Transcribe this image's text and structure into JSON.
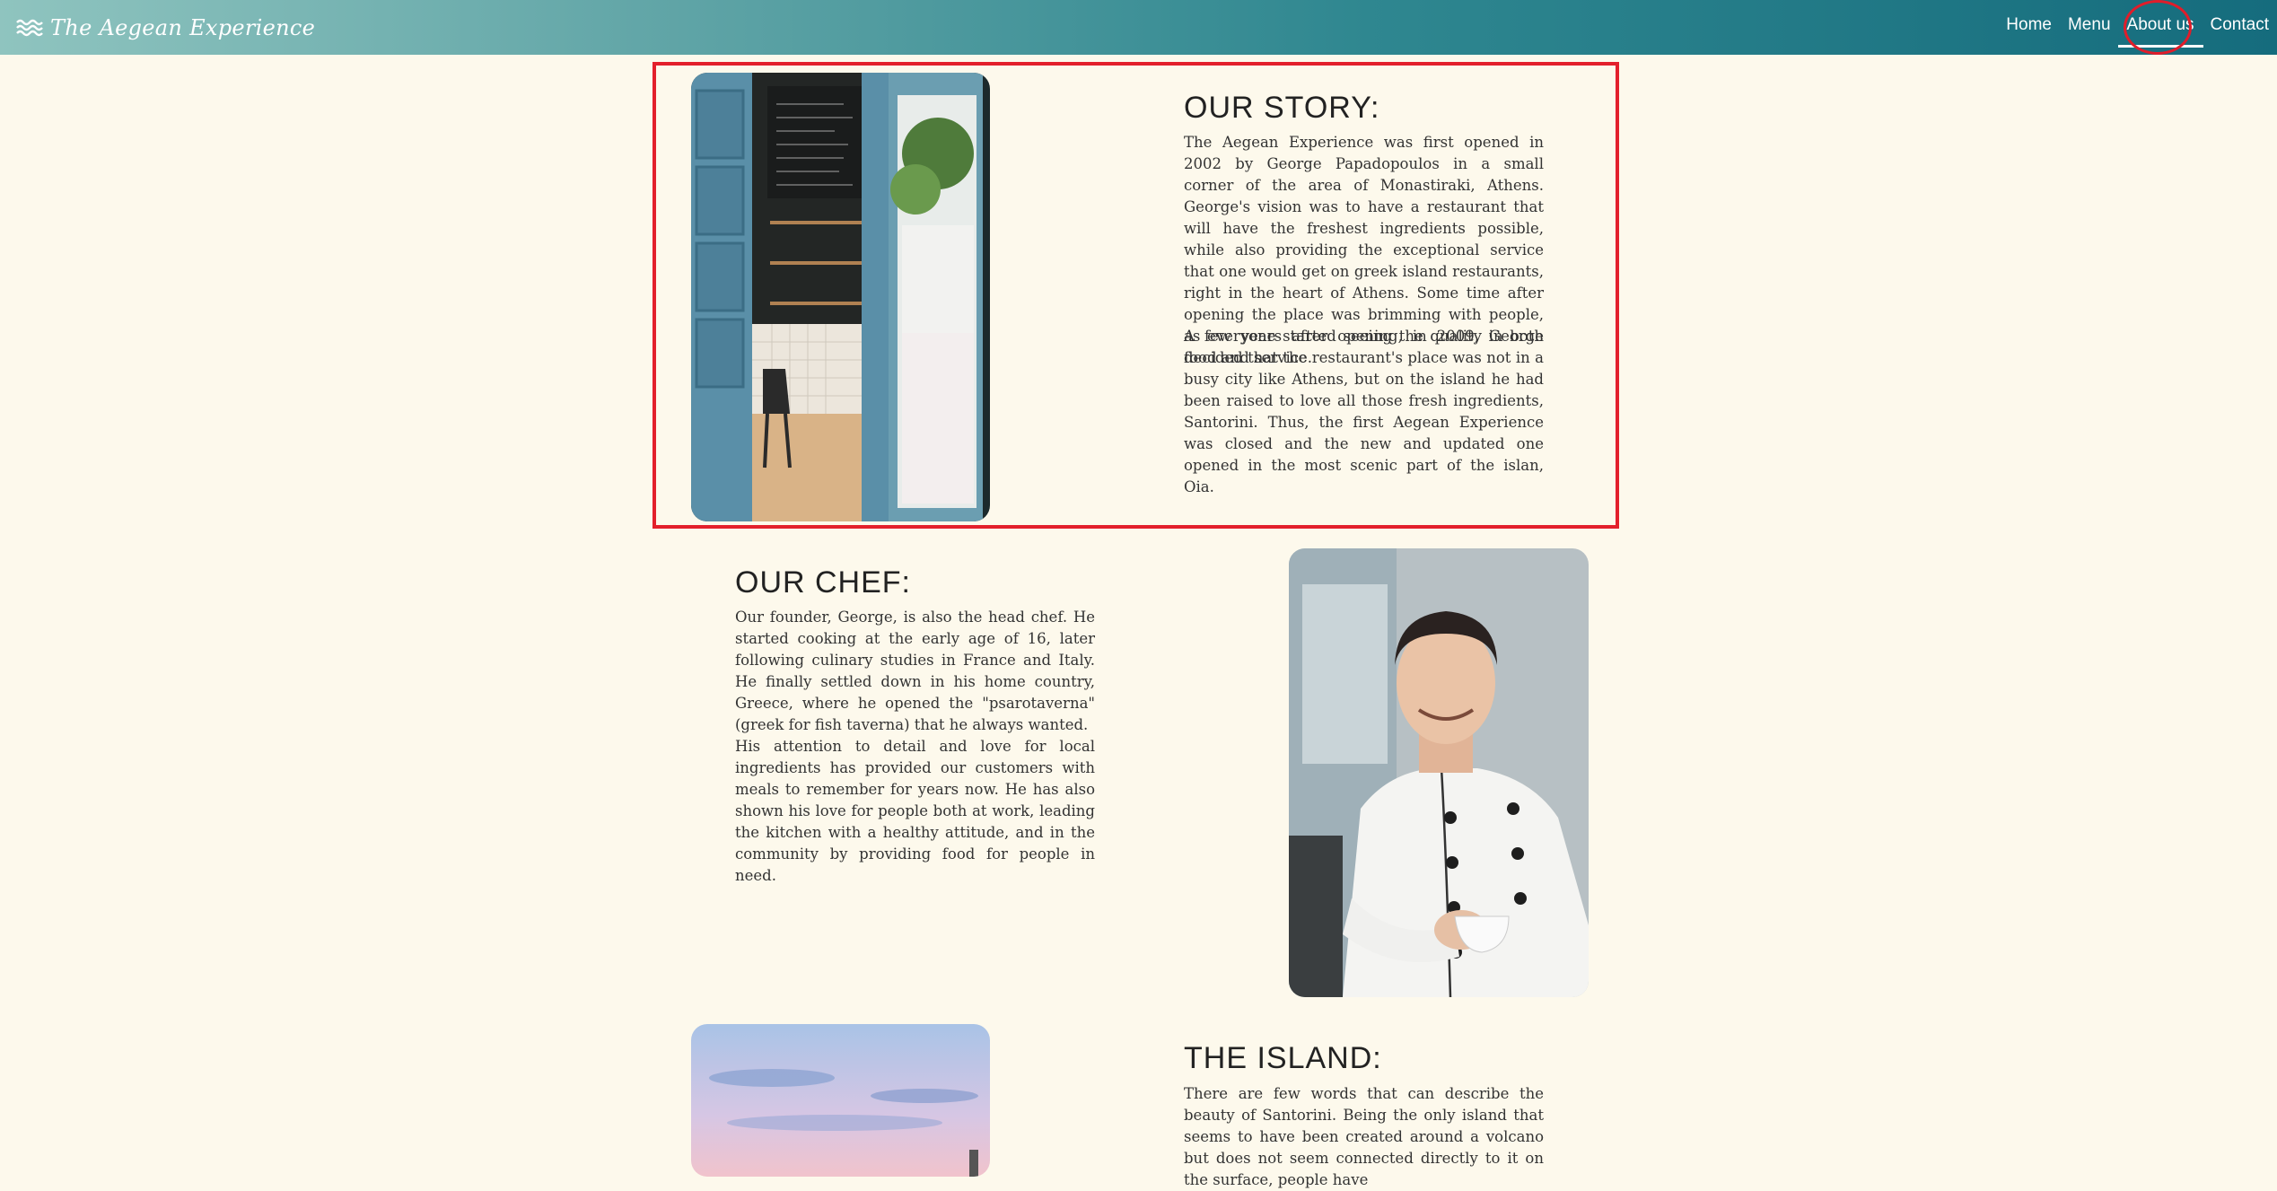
{
  "header": {
    "brand": "The Aegean Experience",
    "brand_icon": "waves-icon",
    "nav": [
      "Home",
      "Menu",
      "About us",
      "Contact"
    ],
    "active": "About us"
  },
  "story": {
    "title": "OUR STORY:",
    "p1": "The Aegean Experience was first opened in 2002 by George Papadopoulos in a small corner of the area of Monastiraki, Athens. George's vision was to have a restaurant that will have the freshest ingredients possible, while also providing the exceptional service that one would get on greek island restaurants, right in the heart of Athens. Some time after opening the place was brimming with people, as everyone started seeing the quality in both food and service.",
    "p2": "A few years after opening, in 2009, George decided that the restaurant's place was not in a busy city like Athens, but on the island he had been raised to love all those fresh ingredients, Santorini. Thus, the first Aegean Experience was closed and the new and updated one opened in the most scenic part of the islan, Oia."
  },
  "chef": {
    "title": "OUR CHEF:",
    "p1": "Our founder, George, is also the head chef. He started cooking at the early age of 16, later following culinary studies in France and Italy. He finally settled down in his home country, Greece, where he opened the \"psarotaverna\" (greek for fish taverna) that he always wanted.",
    "p2": "His attention to detail and love for local ingredients has provided our customers with meals to remember for years now. He has also shown his love for people both at work, leading the kitchen with a healthy attitude, and in the community by providing food for people in need."
  },
  "island": {
    "title": "THE ISLAND:",
    "p1": "There are few words that can describe the beauty of Santorini. Being the only island that seems to have been created around a volcano but does not seem connected directly to it on the surface, people have"
  },
  "colors": {
    "background": "#fdf9ec",
    "nav_gradient_start": "#8fc4bf",
    "nav_gradient_end": "#156c7d",
    "highlight": "#e3202c"
  }
}
